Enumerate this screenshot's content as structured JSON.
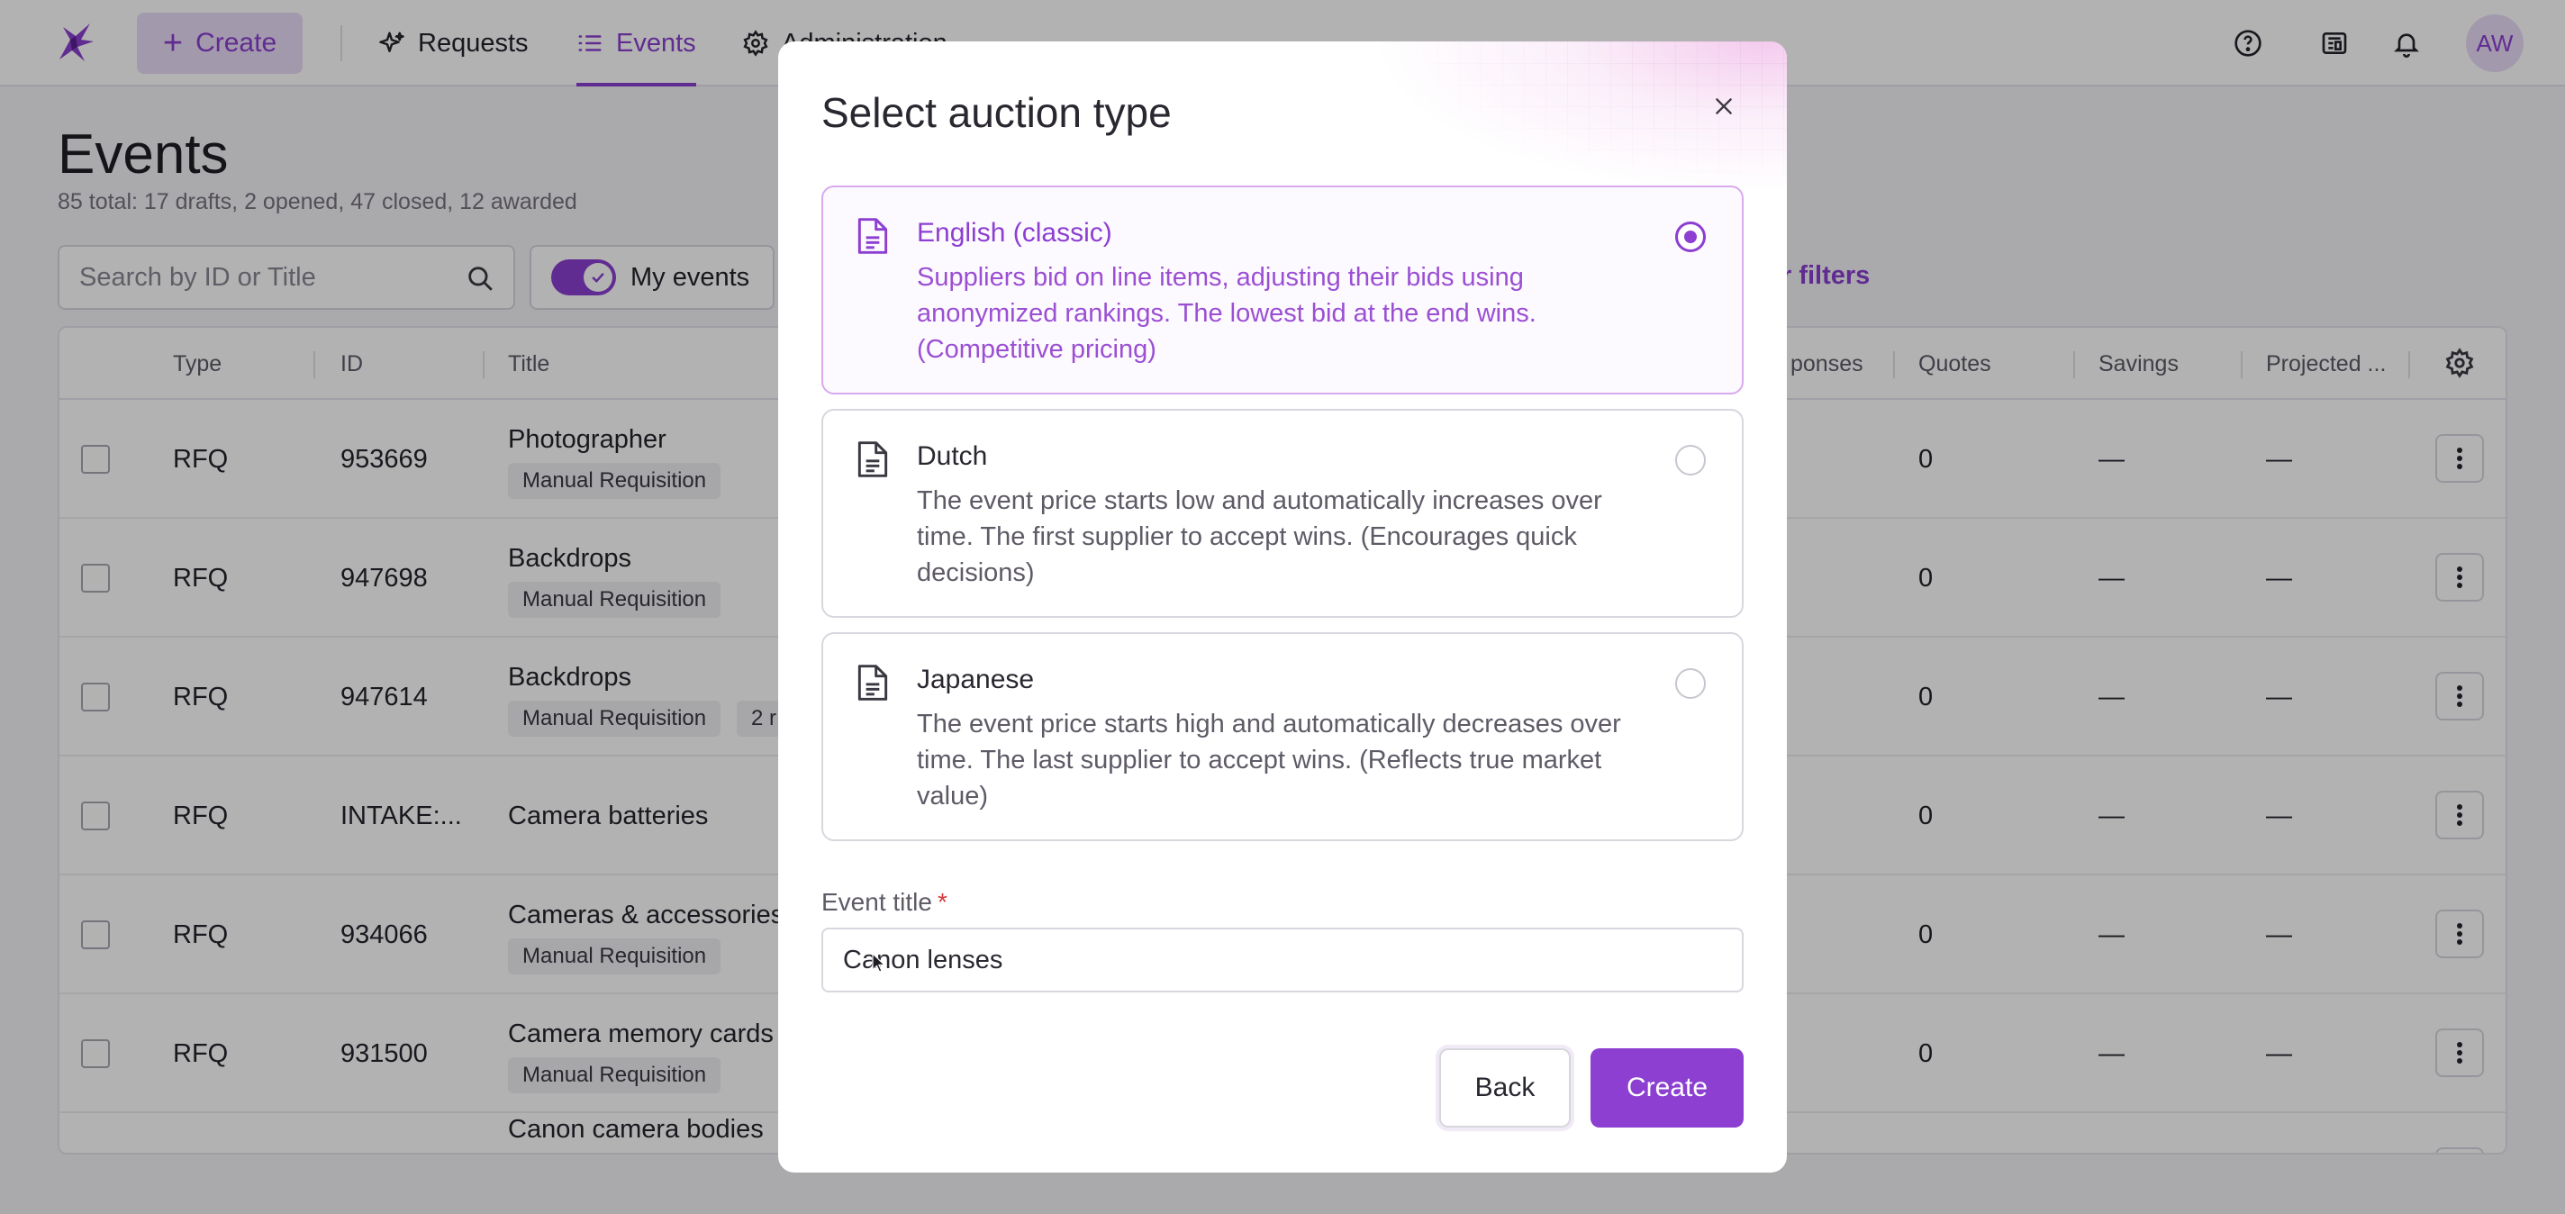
{
  "topbar": {
    "create_label": "Create",
    "nav": [
      {
        "label": "Requests",
        "icon": "sparkles-icon"
      },
      {
        "label": "Events",
        "icon": "list-icon",
        "active": true
      },
      {
        "label": "Administration",
        "icon": "gear-icon"
      }
    ],
    "avatar_initials": "AW",
    "icons": [
      "help-icon",
      "news-icon",
      "bell-icon"
    ]
  },
  "page": {
    "title": "Events",
    "subtitle": "85 total: 17 drafts, 2 opened, 47 closed, 12 awarded",
    "search_placeholder": "Search by ID or Title",
    "my_events_label": "My events",
    "more_filters_label": "r filters"
  },
  "table": {
    "columns": [
      "Type",
      "ID",
      "Title",
      "ponses",
      "Quotes",
      "Savings",
      "Projected ..."
    ],
    "rows": [
      {
        "type": "RFQ",
        "id": "953669",
        "title": "Photographer",
        "tag": "Manual Requisition",
        "extra": "",
        "quotes": "0",
        "savings": "—",
        "projected": "—"
      },
      {
        "type": "RFQ",
        "id": "947698",
        "title": "Backdrops",
        "tag": "Manual Requisition",
        "extra": "",
        "quotes": "0",
        "savings": "—",
        "projected": "—"
      },
      {
        "type": "RFQ",
        "id": "947614",
        "title": "Backdrops",
        "tag": "Manual Requisition",
        "extra": "2 r",
        "quotes": "0",
        "savings": "—",
        "projected": "—"
      },
      {
        "type": "RFQ",
        "id": "INTAKE:...",
        "title": "Camera batteries",
        "tag": "",
        "extra": "",
        "quotes": "0",
        "savings": "—",
        "projected": "—"
      },
      {
        "type": "RFQ",
        "id": "934066",
        "title": "Cameras & accessories",
        "tag": "Manual Requisition",
        "extra": "",
        "quotes": "0",
        "savings": "—",
        "projected": "—"
      },
      {
        "type": "RFQ",
        "id": "931500",
        "title": "Camera memory cards",
        "tag": "Manual Requisition",
        "extra": "",
        "quotes": "0",
        "savings": "—",
        "projected": "—"
      },
      {
        "type": "",
        "id": "",
        "title": "Canon camera bodies",
        "tag": "",
        "extra": "",
        "quotes": "",
        "savings": "",
        "projected": ""
      }
    ]
  },
  "modal": {
    "title": "Select auction type",
    "options": [
      {
        "title": "English (classic)",
        "description": "Suppliers bid on line items, adjusting their bids using anonymized rankings. The lowest bid at the end wins. (Competitive pricing)",
        "selected": true
      },
      {
        "title": "Dutch",
        "description": "The event price starts low and automatically increases over time. The first supplier to accept wins. (Encourages quick decisions)",
        "selected": false
      },
      {
        "title": "Japanese",
        "description": "The event price starts high and automatically decreases over time. The last supplier to accept wins. (Reflects true market value)",
        "selected": false
      }
    ],
    "field_label": "Event title",
    "field_required_mark": "*",
    "field_value": "Canon lenses",
    "back_label": "Back",
    "create_label": "Create"
  },
  "colors": {
    "accent": "#8c3fd1",
    "accent_light": "#eadcf7",
    "required": "#d9383a"
  }
}
